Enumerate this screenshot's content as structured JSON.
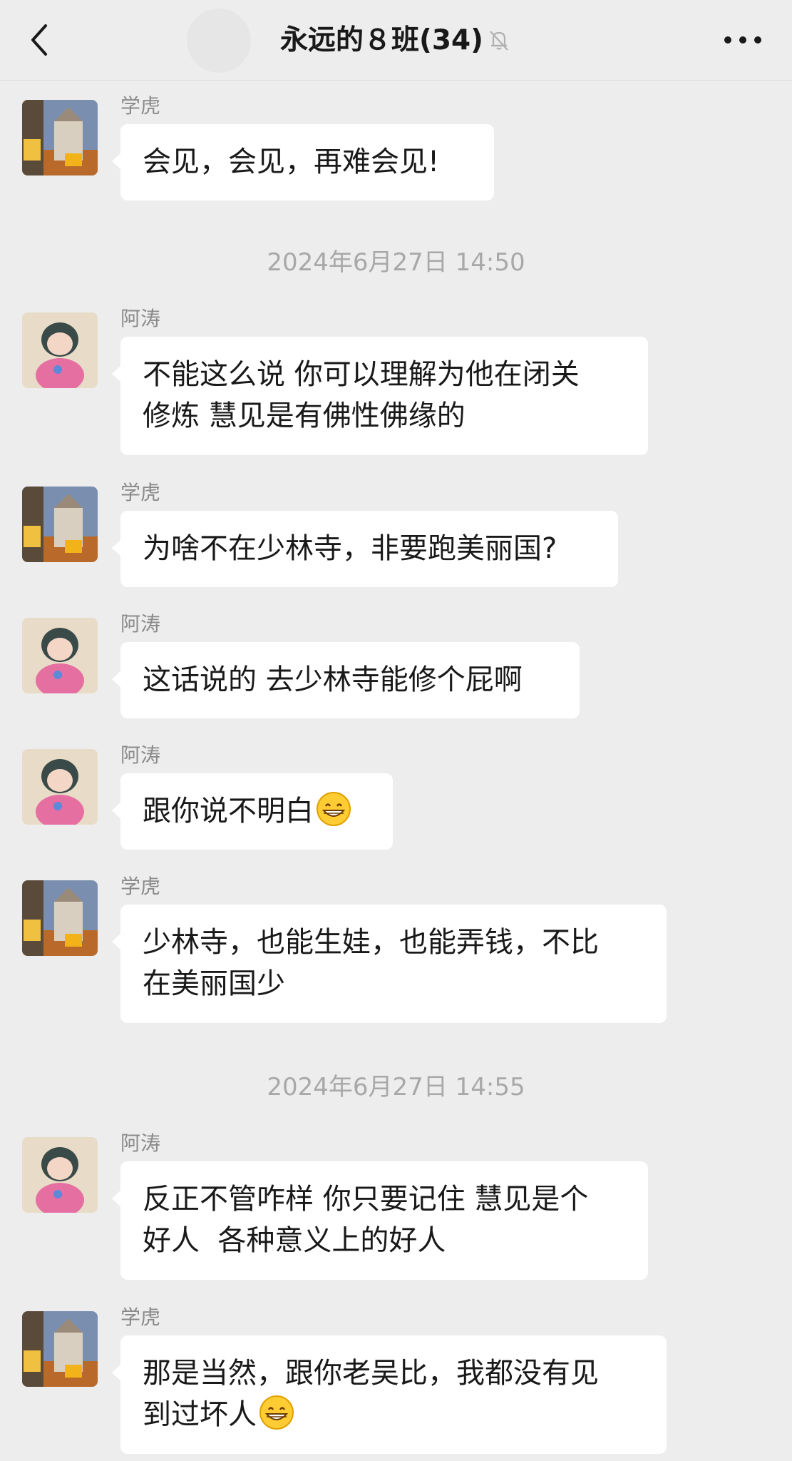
{
  "header": {
    "title": "永远的８班(34)",
    "back_icon": "chevron-left-icon",
    "mute_icon": "bell-muted-icon",
    "more_icon": "more-dots-icon"
  },
  "messages": [
    {
      "type": "msg",
      "sender": "学虎",
      "avatar": "tower-avatar",
      "text": "会见，会见，再难会见!"
    },
    {
      "type": "time",
      "text": "2024年6月27日 14:50"
    },
    {
      "type": "msg",
      "sender": "阿涛",
      "avatar": "girl-avatar",
      "text": "不能这么说 你可以理解为他在闭关\n修炼 慧见是有佛性佛缘的"
    },
    {
      "type": "msg",
      "sender": "学虎",
      "avatar": "tower-avatar",
      "text": "为啥不在少林寺，非要跑美丽国?"
    },
    {
      "type": "msg",
      "sender": "阿涛",
      "avatar": "girl-avatar",
      "text": "这话说的 去少林寺能修个屁啊"
    },
    {
      "type": "msg",
      "sender": "阿涛",
      "avatar": "girl-avatar",
      "text": "跟你说不明白",
      "emoji": "grin-emoji"
    },
    {
      "type": "msg",
      "sender": "学虎",
      "avatar": "tower-avatar",
      "text": "少林寺，也能生娃，也能弄钱，不比\n在美丽国少"
    },
    {
      "type": "time",
      "text": "2024年6月27日 14:55"
    },
    {
      "type": "msg",
      "sender": "阿涛",
      "avatar": "girl-avatar",
      "text": "反正不管咋样 你只要记住 慧见是个\n好人  各种意义上的好人"
    },
    {
      "type": "msg",
      "sender": "学虎",
      "avatar": "tower-avatar",
      "text": "那是当然，跟你老吴比，我都没有见\n到过坏人",
      "emoji": "grin-emoji"
    }
  ]
}
